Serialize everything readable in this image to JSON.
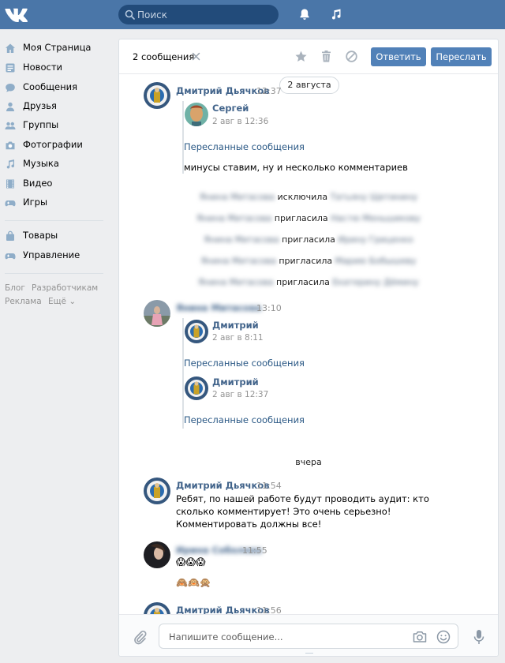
{
  "topbar": {
    "search_placeholder": "Поиск",
    "accent": "#4a76a8"
  },
  "sidebar": {
    "items": [
      {
        "label": "Моя Страница",
        "icon": "home-icon"
      },
      {
        "label": "Новости",
        "icon": "news-icon"
      },
      {
        "label": "Сообщения",
        "icon": "messages-icon"
      },
      {
        "label": "Друзья",
        "icon": "friends-icon"
      },
      {
        "label": "Группы",
        "icon": "groups-icon"
      },
      {
        "label": "Фотографии",
        "icon": "photos-icon"
      },
      {
        "label": "Музыка",
        "icon": "music-icon"
      },
      {
        "label": "Видео",
        "icon": "video-icon"
      },
      {
        "label": "Игры",
        "icon": "games-icon"
      }
    ],
    "extra_items": [
      {
        "label": "Товары",
        "icon": "bag-icon"
      },
      {
        "label": "Управление",
        "icon": "gamepad-icon"
      }
    ],
    "footer": {
      "blog": "Блог",
      "developers": "Разработчикам",
      "ads": "Реклама",
      "more": "Ещё ⌄"
    }
  },
  "header": {
    "selected_count": "2 сообщения",
    "reply": "Ответить",
    "forward": "Переслать"
  },
  "date_pill": "2 августа",
  "messages": {
    "m1": {
      "author": "Дмитрий Дьячков",
      "time": "12:37",
      "fwd_name": "Сергей",
      "fwd_time": "2 авг в 12:36",
      "fwd_link": "Пересланные сообщения",
      "text": "минусы ставим, ну и несколько комментариев"
    },
    "system": [
      {
        "left": "Янина Митасова",
        "action": "исключила",
        "right": "Татьяну Щетинину"
      },
      {
        "left": "Янина Митасова",
        "action": "пригласила",
        "right": "Настю Меньшикову"
      },
      {
        "left": "Янина Митасова",
        "action": "пригласила",
        "right": "Ирину Гриценко"
      },
      {
        "left": "Янина Митасова",
        "action": "пригласила",
        "right": "Марию Бобышеву"
      },
      {
        "left": "Янина Митасова",
        "action": "пригласила",
        "right": "Екатерину Дёмину"
      }
    ],
    "m2": {
      "author": "Янина Митасова",
      "time": "13:10",
      "fwd1_name": "Дмитрий",
      "fwd1_time": "2 авг в 8:11",
      "fwd1_link": "Пересланные сообщения",
      "fwd2_name": "Дмитрий",
      "fwd2_time": "2 авг в 12:37",
      "fwd2_link": "Пересланные сообщения"
    },
    "day_sep": "вчера",
    "m3": {
      "author": "Дмитрий Дьячков",
      "time": "11:54",
      "text": "Ребят, по нашей работе будут проводить аудит: кто сколько комментирует! Это очень серьезно! Комментировать должны все!"
    },
    "m4": {
      "author": "Ирина Соболева",
      "time": "11:55",
      "emoji1": "😱😱😱",
      "emoji2": "🙈🙉🙊"
    },
    "m5": {
      "author": "Дмитрий Дьячков",
      "time": "11:56"
    }
  },
  "composer": {
    "placeholder": "Напишите сообщение..."
  }
}
